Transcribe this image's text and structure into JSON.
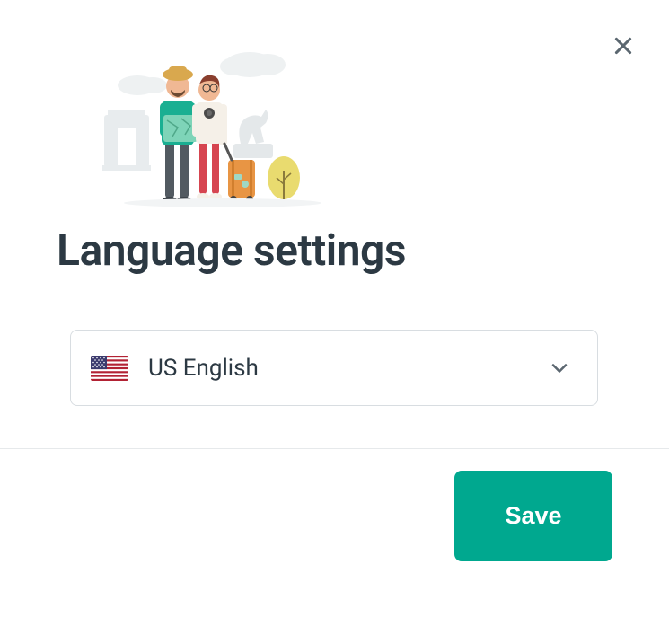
{
  "dialog": {
    "title": "Language settings",
    "close_aria": "Close"
  },
  "language": {
    "selected_label": "US English",
    "selected_flag": "us"
  },
  "footer": {
    "save_label": "Save"
  },
  "colors": {
    "accent": "#00a88f",
    "text_primary": "#2c3943",
    "text_secondary": "#5b6770",
    "border": "#d8dde1"
  }
}
